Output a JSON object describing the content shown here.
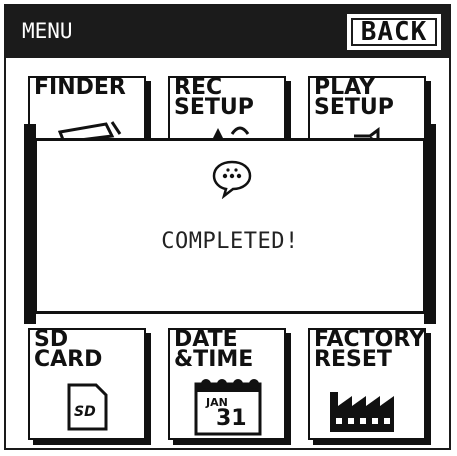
{
  "header": {
    "title": "MENU",
    "back_label": "BACK"
  },
  "tiles": [
    {
      "label": "FINDER",
      "icon": "folder-icon"
    },
    {
      "label": "REC\nSETUP",
      "icon": "microphone-icon"
    },
    {
      "label": "PLAY\nSETUP",
      "icon": "speaker-icon"
    },
    {
      "label": "SD\nCARD",
      "icon": "sd-card-icon",
      "icon_text": "SD"
    },
    {
      "label": "DATE\n&TIME",
      "icon": "calendar-icon",
      "month": "JAN",
      "day": "31"
    },
    {
      "label": "FACTORY\nRESET",
      "icon": "factory-icon"
    }
  ],
  "dialog": {
    "message": "COMPLETED!",
    "icon": "speech-bubble-icon"
  }
}
